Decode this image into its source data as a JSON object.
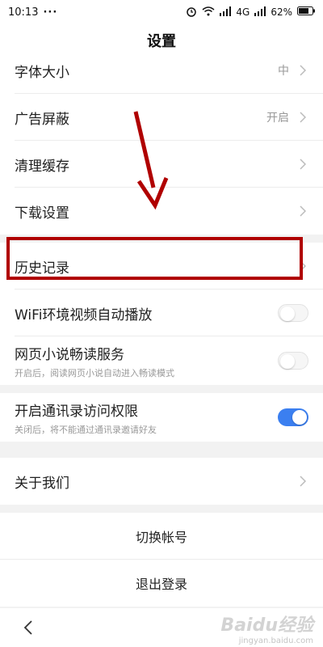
{
  "status_bar": {
    "time": "10:13",
    "dots": "···",
    "network": "4G",
    "battery": "62%"
  },
  "header": {
    "title": "设置"
  },
  "group1": [
    {
      "label": "字体大小",
      "value": "中"
    },
    {
      "label": "广告屏蔽",
      "value": "开启"
    },
    {
      "label": "清理缓存",
      "value": ""
    },
    {
      "label": "下载设置",
      "value": ""
    }
  ],
  "group2": {
    "history": {
      "label": "历史记录"
    },
    "wifi_autoplay": {
      "label": "WiFi环境视频自动播放",
      "on": false
    },
    "novel": {
      "label": "网页小说畅读服务",
      "sub": "开启后，阅读网页小说自动进入畅读模式",
      "on": false
    }
  },
  "group3": {
    "contacts": {
      "label": "开启通讯录访问权限",
      "sub": "关闭后，将不能通过通讯录邀请好友",
      "on": true
    }
  },
  "group4": {
    "about": {
      "label": "关于我们"
    }
  },
  "group5": {
    "switch_account": "切换帐号",
    "logout": "退出登录"
  },
  "watermark": {
    "main": "Baidu经验",
    "sub": "jingyan.baidu.com"
  },
  "colors": {
    "accent_blue": "#3b7ff0",
    "annotation_red": "#b00000"
  }
}
